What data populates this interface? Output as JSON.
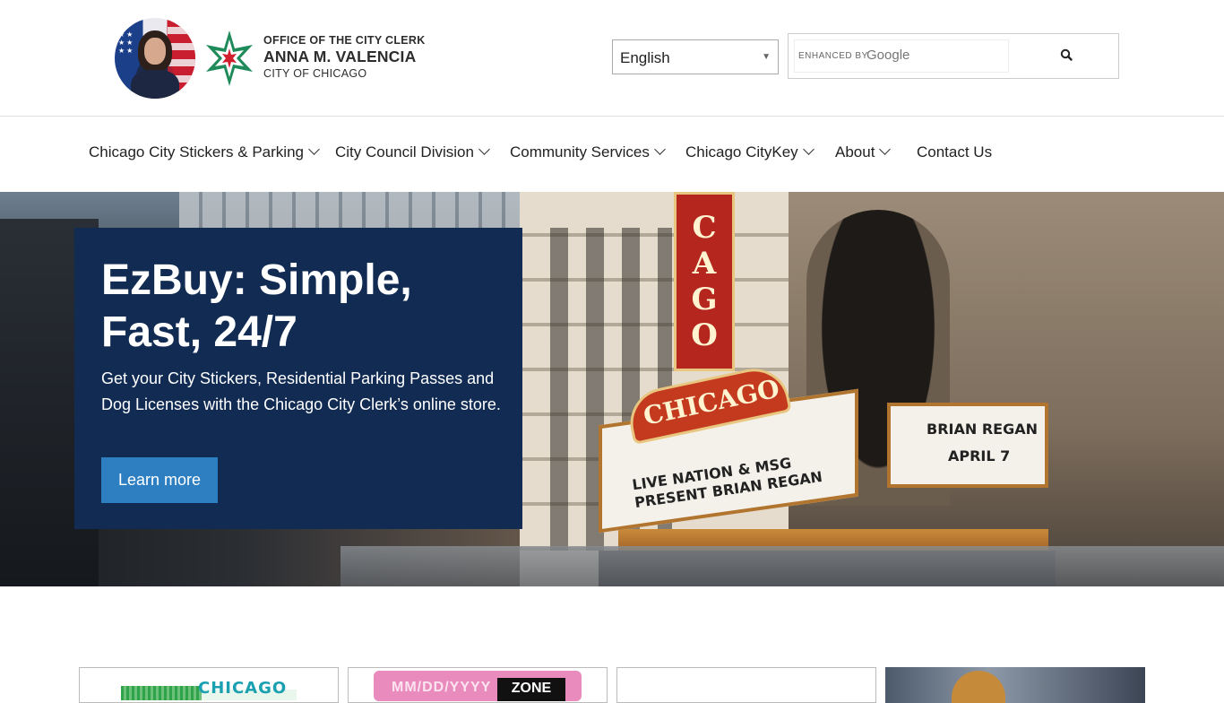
{
  "header": {
    "brand_line1": "OFFICE OF THE CITY CLERK",
    "brand_line2": "ANNA M. VALENCIA",
    "brand_line3": "CITY OF CHICAGO",
    "language_select": {
      "value": "English"
    },
    "search": {
      "enhanced_label": "ENHANCED BY",
      "google_label": "Google"
    }
  },
  "nav": {
    "items": [
      {
        "label": "Chicago City Stickers & Parking",
        "has_dropdown": true
      },
      {
        "label": "City Council Division",
        "has_dropdown": true
      },
      {
        "label": "Community Services",
        "has_dropdown": true
      },
      {
        "label": "Chicago CityKey",
        "has_dropdown": true
      },
      {
        "label": "About",
        "has_dropdown": true
      },
      {
        "label": "Contact Us",
        "has_dropdown": false
      }
    ]
  },
  "hero": {
    "title": "EzBuy: Simple, Fast, 24/7",
    "description": "Get your City Stickers, Residential Parking Passes and Dog Licenses with the Chicago City Clerk’s online store.",
    "cta_label": "Learn more",
    "photo_sign_vertical": "CAGO",
    "photo_sign_arch": "CHICAGO",
    "photo_marquee_left": "LIVE NATION & MSG PRESENT BRIAN REGAN",
    "photo_marquee_right_1": "BRIAN REGAN",
    "photo_marquee_right_2": "APRIL 7",
    "card_color": "#112b53",
    "cta_color": "#2d7fc1"
  },
  "cards": {
    "card1_word": "CHICAGO",
    "card2_date": "MM/DD/YYYY",
    "card2_zone": "ZONE"
  }
}
